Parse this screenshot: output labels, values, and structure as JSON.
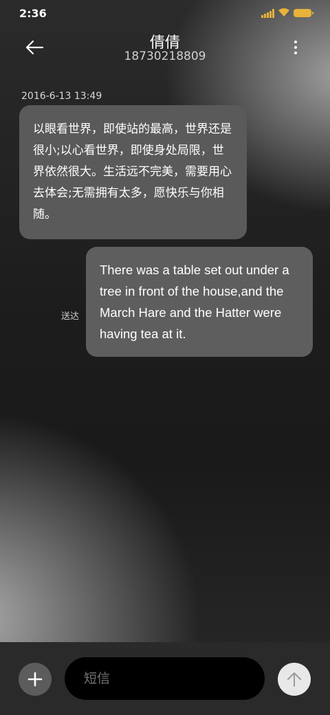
{
  "status_bar": {
    "time": "2:36"
  },
  "header": {
    "contact_name": "倩倩",
    "phone_number": "18730218809"
  },
  "conversation": {
    "timestamp": "2016-6-13 13:49",
    "messages": [
      {
        "direction": "incoming",
        "text": "以眼看世界，即使站的最高，世界还是很小;以心看世界，即使身处局限，世界依然很大。生活远不完美，需要用心去体会;无需拥有太多，愿快乐与你相随。"
      },
      {
        "direction": "outgoing",
        "text": "There was a table set out under a tree in front of the house,and the March Hare and the Hatter were having tea at it.",
        "status": "送达"
      }
    ]
  },
  "composer": {
    "placeholder": "短信"
  },
  "icons": {
    "back": "arrow-left-icon",
    "more": "more-vertical-icon",
    "add": "plus-icon",
    "send": "arrow-up-icon"
  },
  "colors": {
    "status_accent": "#e8b23a",
    "bubble_incoming": "#5a5a5a",
    "bubble_outgoing": "#5e5e5e",
    "composer_bar": "#2a2a2a"
  }
}
